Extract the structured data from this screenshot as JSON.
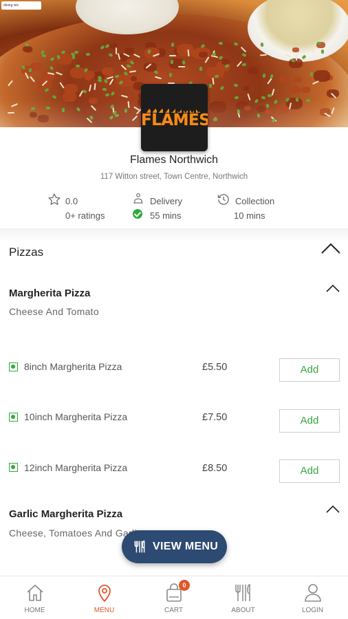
{
  "hero": {
    "powered_by": "dining wiz"
  },
  "store": {
    "logo_text": "FLAMES",
    "name": "Flames Northwich",
    "address": "117 Witton street, Town Centre, Northwich"
  },
  "stats": {
    "rating_value": "0.0",
    "rating_count": "0+ ratings",
    "delivery_label": "Delivery",
    "delivery_time": "55 mins",
    "collection_label": "Collection",
    "collection_time": "10 mins"
  },
  "category": {
    "title": "Pizzas"
  },
  "items": [
    {
      "title": "Margherita Pizza",
      "description": "Cheese And Tomato",
      "options": [
        {
          "name": "8inch Margherita Pizza",
          "price": "£5.50",
          "add_label": "Add"
        },
        {
          "name": "10inch Margherita Pizza",
          "price": "£7.50",
          "add_label": "Add"
        },
        {
          "name": "12inch Margherita Pizza",
          "price": "£8.50",
          "add_label": "Add"
        }
      ]
    },
    {
      "title": "Garlic Margherita Pizza",
      "description": "Cheese, Tomatoes And Garlic"
    }
  ],
  "view_menu": {
    "label": "VIEW MENU"
  },
  "nav": {
    "items": [
      {
        "label": "HOME",
        "icon": "home-icon"
      },
      {
        "label": "MENU",
        "icon": "location-pin-icon",
        "active": true
      },
      {
        "label": "CART",
        "icon": "shopping-bag-icon",
        "badge": "0"
      },
      {
        "label": "ABOUT",
        "icon": "cutlery-icon"
      },
      {
        "label": "LOGIN",
        "icon": "user-icon"
      }
    ]
  },
  "colors": {
    "accent": "#e2562a",
    "green": "#2faa3c",
    "button_navy": "#2d4a72"
  }
}
